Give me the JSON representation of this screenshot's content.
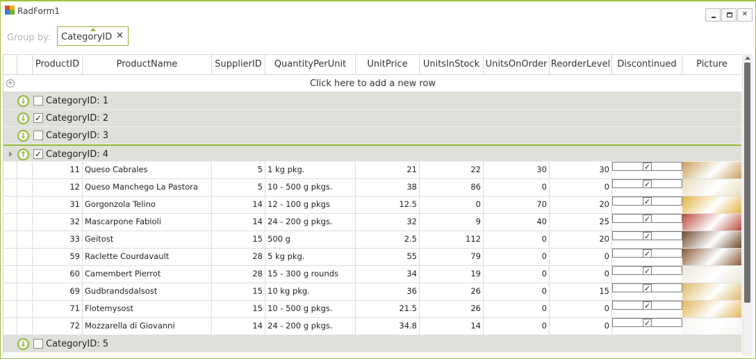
{
  "window": {
    "title": "RadForm1",
    "min_icon": "minimize-icon",
    "max_icon": "maximize-icon",
    "close_glyph": "✕"
  },
  "groupby": {
    "label": "Group by:",
    "chip_label": "CategoryID",
    "chip_close": "✕"
  },
  "columns": [
    "ProductID",
    "ProductName",
    "SupplierID",
    "QuantityPerUnit",
    "UnitPrice",
    "UnitsInStock",
    "UnitsOnOrder",
    "ReorderLevel",
    "Discontinued",
    "Picture"
  ],
  "new_row_text": "Click here to add a new row",
  "groups": [
    {
      "label": "CategoryID: 1",
      "checked": false,
      "expanded": false
    },
    {
      "label": "CategoryID: 2",
      "checked": true,
      "expanded": false
    },
    {
      "label": "CategoryID: 3",
      "checked": false,
      "expanded": false
    },
    {
      "label": "CategoryID: 4",
      "checked": true,
      "expanded": true
    },
    {
      "label": "CategoryID: 5",
      "checked": false,
      "expanded": false
    }
  ],
  "rows": [
    {
      "ProductID": "11",
      "ProductName": "Queso Cabrales",
      "SupplierID": "5",
      "QuantityPerUnit": "1 kg pkg.",
      "UnitPrice": "21",
      "UnitsInStock": "22",
      "UnitsOnOrder": "30",
      "ReorderLevel": "30",
      "Discontinued": true,
      "picture_color": "#c9a05b"
    },
    {
      "ProductID": "12",
      "ProductName": "Queso Manchego La Pastora",
      "SupplierID": "5",
      "QuantityPerUnit": "10 - 500 g pkgs.",
      "UnitPrice": "38",
      "UnitsInStock": "86",
      "UnitsOnOrder": "0",
      "ReorderLevel": "0",
      "Discontinued": true,
      "picture_color": "#e8dcc0"
    },
    {
      "ProductID": "31",
      "ProductName": "Gorgonzola Telino",
      "SupplierID": "14",
      "QuantityPerUnit": "12 - 100 g pkgs",
      "UnitPrice": "12.5",
      "UnitsInStock": "0",
      "UnitsOnOrder": "70",
      "ReorderLevel": "20",
      "Discontinued": true,
      "picture_color": "#e2b446"
    },
    {
      "ProductID": "32",
      "ProductName": "Mascarpone Fabioli",
      "SupplierID": "14",
      "QuantityPerUnit": "24 - 200 g pkgs.",
      "UnitPrice": "32",
      "UnitsInStock": "9",
      "UnitsOnOrder": "40",
      "ReorderLevel": "25",
      "Discontinued": true,
      "picture_color": "#b9493a"
    },
    {
      "ProductID": "33",
      "ProductName": "Geitost",
      "SupplierID": "15",
      "QuantityPerUnit": "500 g",
      "UnitPrice": "2.5",
      "UnitsInStock": "112",
      "UnitsOnOrder": "0",
      "ReorderLevel": "20",
      "Discontinued": true,
      "picture_color": "#6b4a2e"
    },
    {
      "ProductID": "59",
      "ProductName": "Raclette Courdavault",
      "SupplierID": "28",
      "QuantityPerUnit": "5 kg pkg.",
      "UnitPrice": "55",
      "UnitsInStock": "79",
      "UnitsOnOrder": "0",
      "ReorderLevel": "0",
      "Discontinued": true,
      "picture_color": "#8a5a36"
    },
    {
      "ProductID": "60",
      "ProductName": "Camembert Pierrot",
      "SupplierID": "28",
      "QuantityPerUnit": "15 - 300 g rounds",
      "UnitPrice": "34",
      "UnitsInStock": "19",
      "UnitsOnOrder": "0",
      "ReorderLevel": "0",
      "Discontinued": true,
      "picture_color": "#ece6d8"
    },
    {
      "ProductID": "69",
      "ProductName": "Gudbrandsdalsost",
      "SupplierID": "15",
      "QuantityPerUnit": "10 kg pkg.",
      "UnitPrice": "36",
      "UnitsInStock": "26",
      "UnitsOnOrder": "0",
      "ReorderLevel": "15",
      "Discontinued": true,
      "picture_color": "#d9ba6a"
    },
    {
      "ProductID": "71",
      "ProductName": "Flotemysost",
      "SupplierID": "15",
      "QuantityPerUnit": "10 - 500 g pkgs.",
      "UnitPrice": "21.5",
      "UnitsInStock": "26",
      "UnitsOnOrder": "0",
      "ReorderLevel": "0",
      "Discontinued": true,
      "picture_color": "#e1b55a"
    },
    {
      "ProductID": "72",
      "ProductName": "Mozzarella di Giovanni",
      "SupplierID": "14",
      "QuantityPerUnit": "24 - 200 g pkgs.",
      "UnitPrice": "34.8",
      "UnitsInStock": "14",
      "UnitsOnOrder": "0",
      "ReorderLevel": "0",
      "Discontinued": true,
      "picture_color": "#f4f4f0"
    }
  ],
  "colors": {
    "accent": "#8fb637",
    "group_bg": "#dfe0d9",
    "border": "#d6d6d6"
  }
}
